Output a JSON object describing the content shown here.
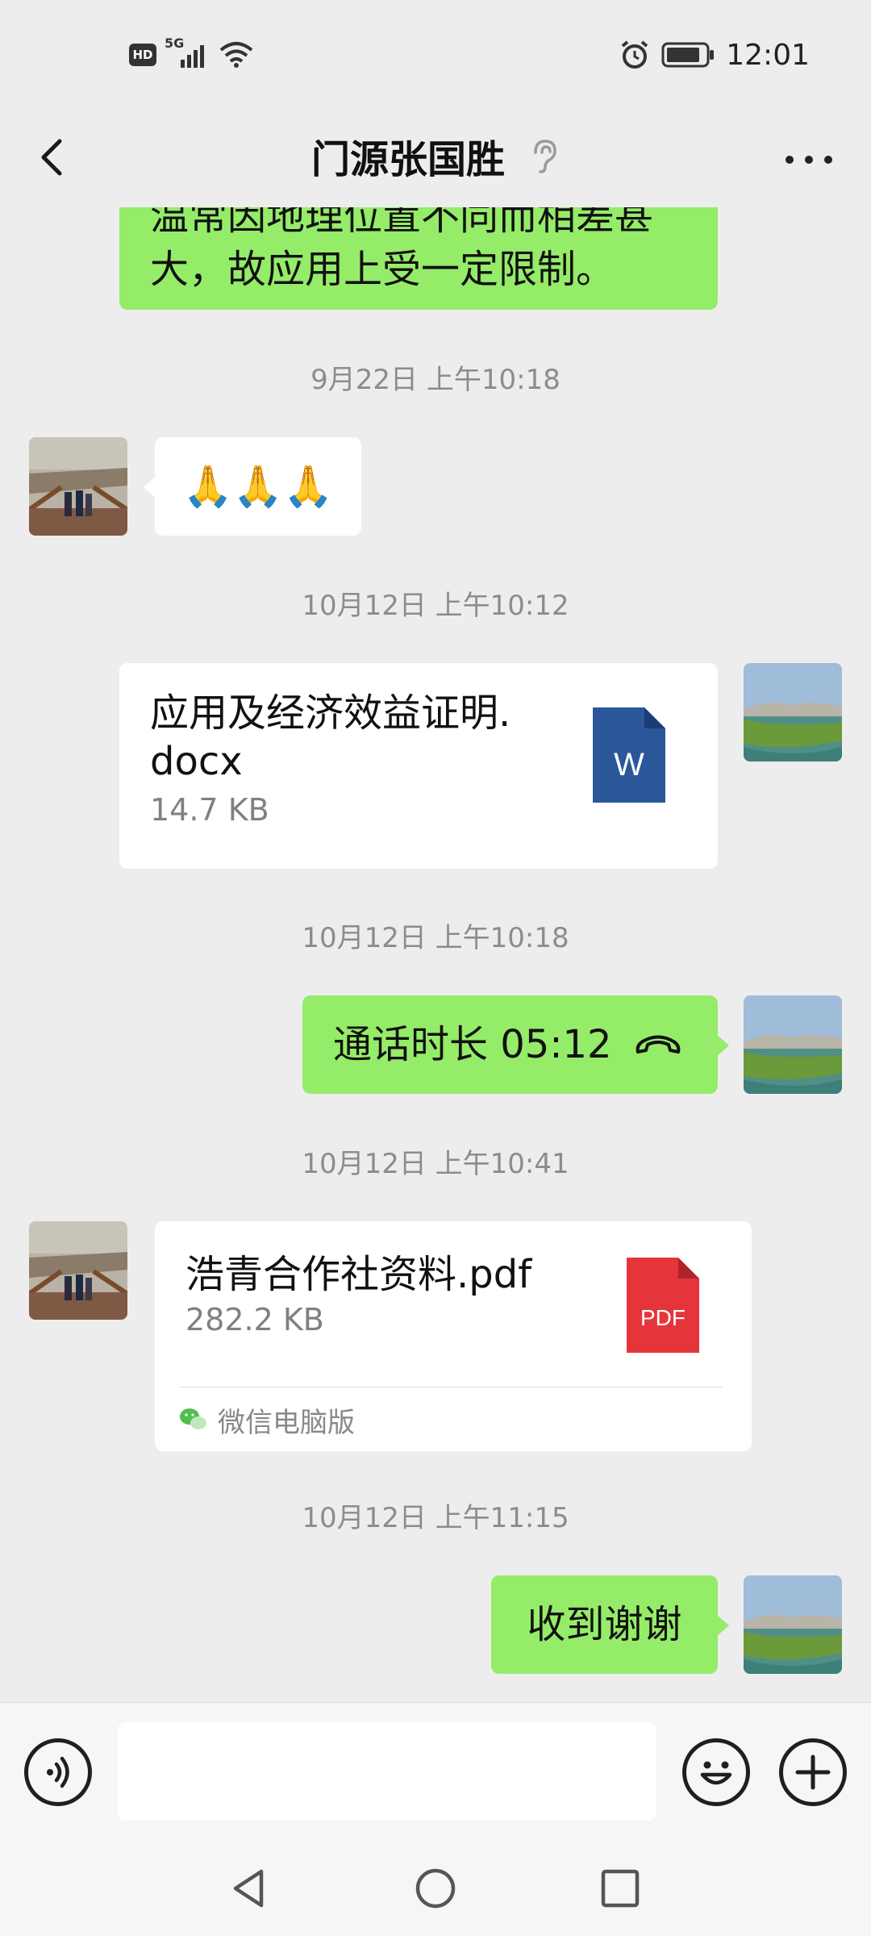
{
  "status_bar": {
    "hd": "HD",
    "network": "5G",
    "time": "12:01"
  },
  "header": {
    "title": "门源张国胜"
  },
  "messages": {
    "partial_text_line1": "温常因地理位置不同而相差甚",
    "partial_text_line2": "大，故应用上受一定限制。",
    "ts1": "9月22日 上午10:18",
    "emoji_text": "🙏🙏🙏",
    "ts2": "10月12日 上午10:12",
    "file1": {
      "name_line1": "应用及经济效益证明.",
      "name_line2": "docx",
      "size": "14.7 KB",
      "icon_letter": "W"
    },
    "ts3": "10月12日 上午10:18",
    "call_text": "通话时长 05:12",
    "ts4": "10月12日 上午10:41",
    "file2": {
      "name": "浩青合作社资料.pdf",
      "size": "282.2 KB",
      "icon_label": "PDF",
      "source": "微信电脑版"
    },
    "ts5": "10月12日 上午11:15",
    "reply_text": "收到谢谢"
  },
  "input": {
    "value": ""
  },
  "colors": {
    "sent_bubble": "#95ec69",
    "received_bubble": "#ffffff",
    "background": "#ededed",
    "word_blue": "#2b579a",
    "pdf_red": "#e5353b"
  },
  "icons": {
    "back": "chevron-left-icon",
    "ear": "ear-icon",
    "more": "more-dots-icon",
    "voice": "voice-icon",
    "emoji": "emoji-icon",
    "add": "plus-icon",
    "call": "phone-hangup-icon",
    "word": "word-file-icon",
    "pdf": "pdf-file-icon"
  }
}
